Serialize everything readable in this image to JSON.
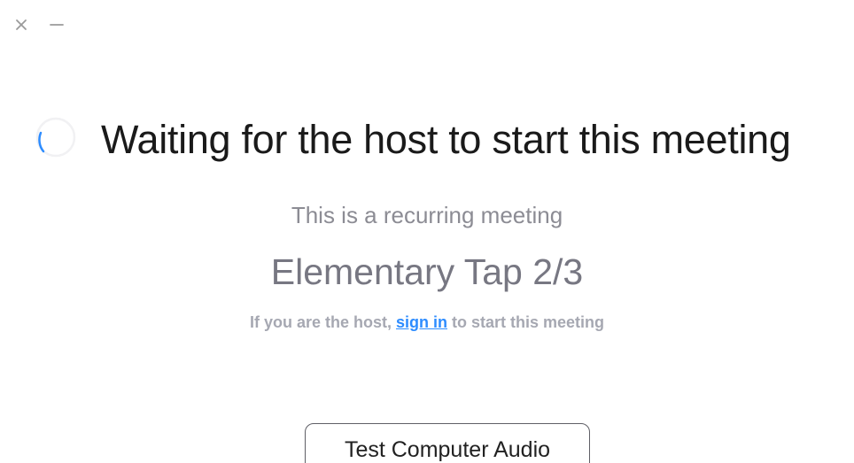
{
  "window_controls": {
    "close_icon": "close-icon",
    "minimize_icon": "minimize-icon"
  },
  "status": {
    "spinner_icon": "loading-spinner-icon",
    "title": "Waiting for the host to start this meeting"
  },
  "meeting": {
    "recurring_text": "This is a recurring meeting",
    "topic": "Elementary Tap 2/3"
  },
  "host_prompt": {
    "prefix": "If you are the host, ",
    "link_text": "sign in",
    "suffix": " to start this meeting"
  },
  "actions": {
    "test_audio_label": "Test Computer Audio"
  },
  "colors": {
    "link": "#2d8cff",
    "title": "#1a1a1a",
    "muted": "#8c8c94"
  }
}
